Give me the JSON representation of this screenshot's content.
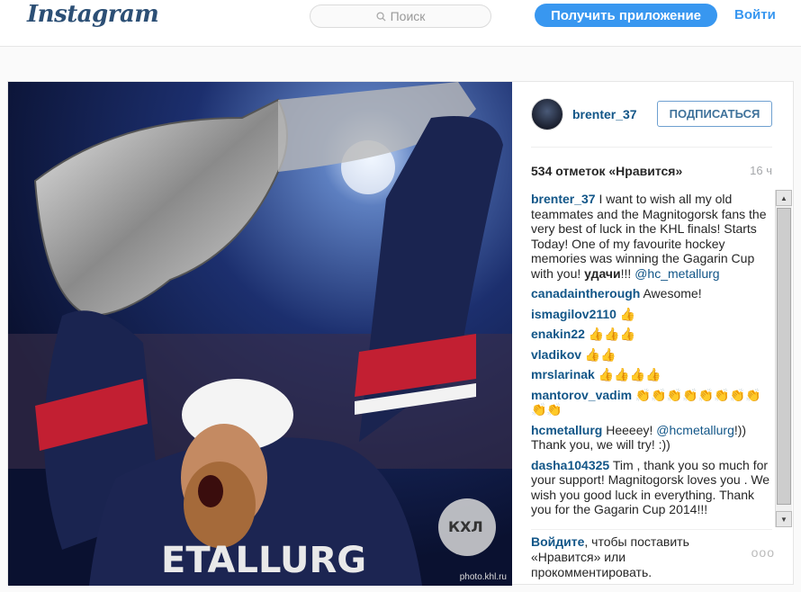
{
  "nav": {
    "logo": "Instagram",
    "search_placeholder": "Поиск",
    "get_app": "Получить приложение",
    "login": "Войти"
  },
  "post": {
    "watermark": "photo.khl.ru",
    "username": "brenter_37",
    "follow": "ПОДПИСАТЬСЯ",
    "likes": "534 отметок «Нравится»",
    "time": "16 ч",
    "caption": {
      "user": "brenter_37",
      "text": " I want to wish all my old teammates and the Magnitogorsk fans the very best of luck in the KHL finals! Starts Today! One of my favourite hockey memories was winning the Gagarin Cup with you! ",
      "bold": "удачи",
      "after_bold": "!!! ",
      "mention": "@hc_metallurg"
    },
    "comments": [
      {
        "user": "canadaintherough",
        "text": " Awesome!"
      },
      {
        "user": "ismagilov2110",
        "text": " 👍"
      },
      {
        "user": "enakin22",
        "text": " 👍👍👍"
      },
      {
        "user": "vladikov",
        "text": " 👍👍"
      },
      {
        "user": "mrslarinak",
        "text": " 👍👍👍👍"
      },
      {
        "user": "mantorov_vadim",
        "text": " 👏👏👏👏👏👏👏👏👏👏"
      },
      {
        "user": "hcmetallurg",
        "text_before": " Heeeey! ",
        "mention": "@hcmetallurg",
        "text_after": "!)) Thank you, we will try! :))"
      },
      {
        "user": "dasha104325",
        "text": " Tim , thank you so much for your support! Magnitogorsk loves you . We wish you good luck in everything. Thank you for the Gagarin Cup 2014!!!"
      }
    ],
    "footer": {
      "login_link": "Войдите",
      "text": ", чтобы поставить «Нравится» или прокомментировать.",
      "more": "ooo"
    }
  },
  "colors": {
    "accent": "#3897f0",
    "link": "#125688"
  }
}
